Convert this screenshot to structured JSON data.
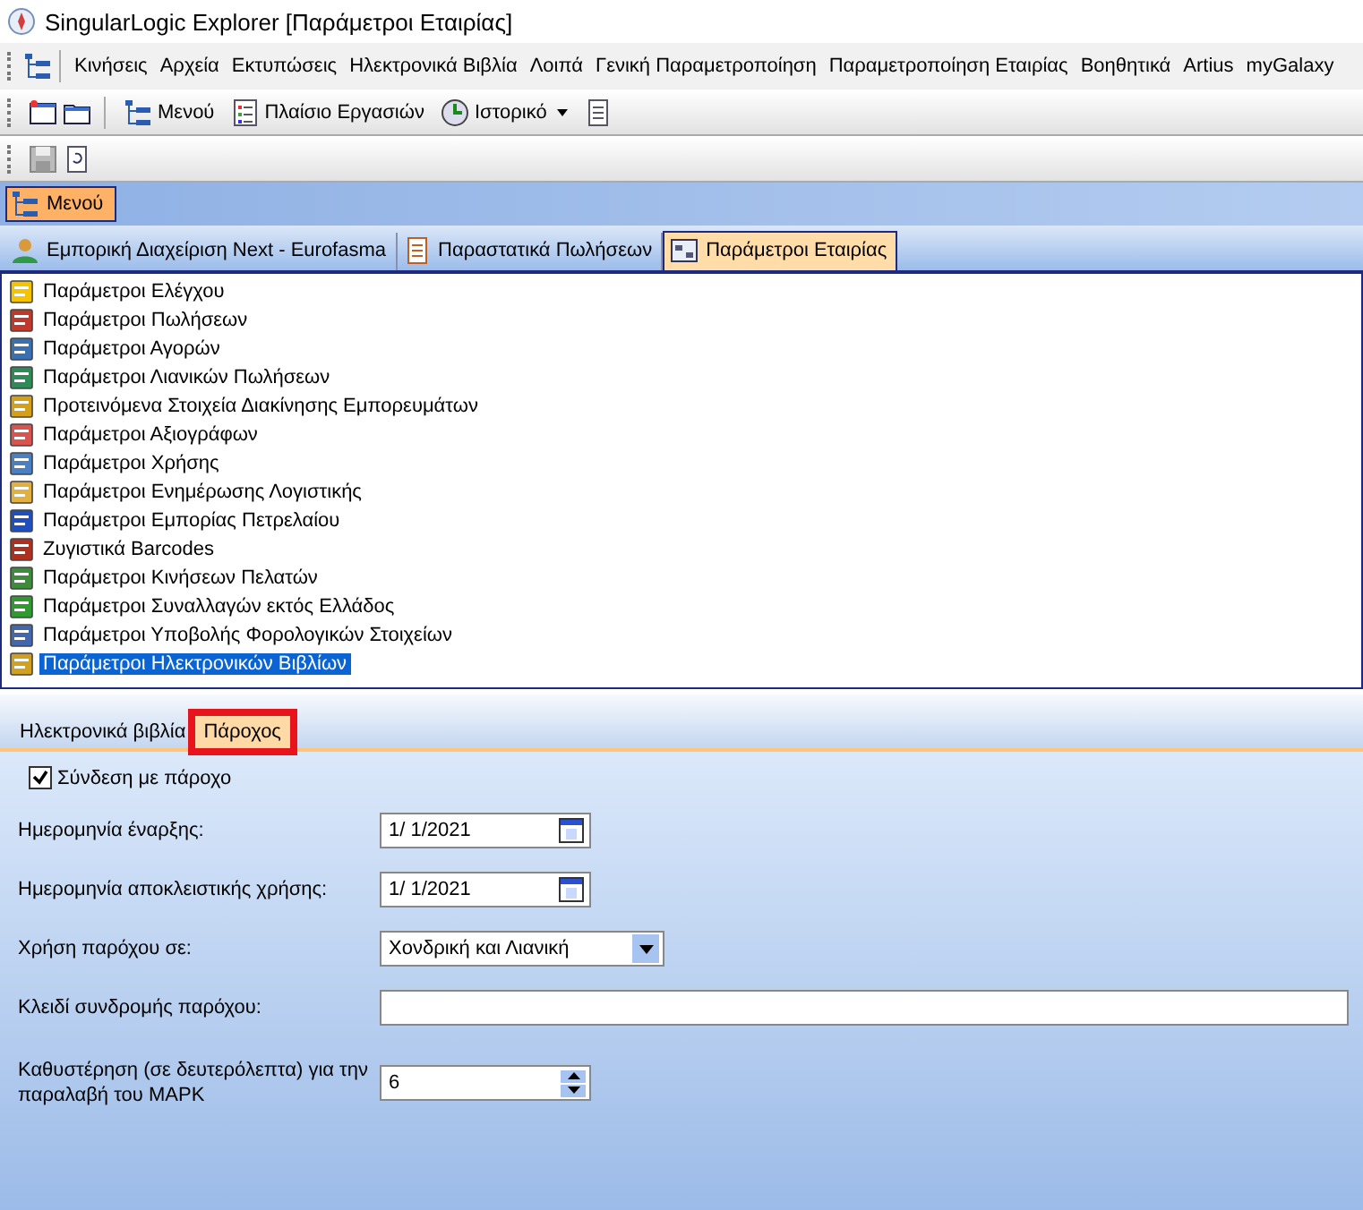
{
  "window": {
    "title": "SingularLogic Explorer [Παράμετροι Εταιρίας]"
  },
  "menu_bar": [
    "Κινήσεις",
    "Αρχεία",
    "Εκτυπώσεις",
    "Ηλεκτρονικά Βιβλία",
    "Λοιπά",
    "Γενική Παραμετροποίηση",
    "Παραμετροποίηση Εταιρίας",
    "Βοηθητικά",
    "Artius",
    "myGalaxy"
  ],
  "toolbar": [
    {
      "label": "Μενού",
      "kind": "button"
    },
    {
      "label": "Πλαίσιο Εργασιών",
      "kind": "button"
    },
    {
      "label": "Ιστορικό",
      "kind": "dropdown"
    }
  ],
  "menu_strip": {
    "label": "Μενού",
    "selected": true
  },
  "doc_tabs": [
    {
      "label": "Εμπορική Διαχείριση Next - Eurofasma",
      "selected": false
    },
    {
      "label": "Παραστατικά Πωλήσεων",
      "selected": false
    },
    {
      "label": "Παράμετροι Εταιρίας",
      "selected": true
    }
  ],
  "param_list": [
    {
      "label": "Παράμετροι Ελέγχου",
      "selected": false
    },
    {
      "label": "Παράμετροι Πωλήσεων",
      "selected": false
    },
    {
      "label": "Παράμετροι Αγορών",
      "selected": false
    },
    {
      "label": "Παράμετροι Λιανικών Πωλήσεων",
      "selected": false
    },
    {
      "label": "Προτεινόμενα Στοιχεία Διακίνησης Εμπορευμάτων",
      "selected": false
    },
    {
      "label": "Παράμετροι Αξιογράφων",
      "selected": false
    },
    {
      "label": "Παράμετροι Χρήσης",
      "selected": false
    },
    {
      "label": "Παράμετροι Ενημέρωσης Λογιστικής",
      "selected": false
    },
    {
      "label": "Παράμετροι Εμπορίας Πετρελαίου",
      "selected": false
    },
    {
      "label": "Ζυγιστικά Barcodes",
      "selected": false
    },
    {
      "label": "Παράμετροι Κινήσεων Πελατών",
      "selected": false
    },
    {
      "label": "Παράμετροι Συναλλαγών εκτός Ελλάδος",
      "selected": false
    },
    {
      "label": "Παράμετροι Υποβολής Φορολογικών Στοιχείων",
      "selected": false
    },
    {
      "label": "Παράμετροι Ηλεκτρονικών Βιβλίων",
      "selected": true
    }
  ],
  "sub_tabs": [
    {
      "label": "Ηλεκτρονικά βιβλία",
      "selected": false,
      "highlighted": false
    },
    {
      "label": "Πάροχος",
      "selected": true,
      "highlighted": true
    }
  ],
  "form": {
    "checkbox": {
      "label": "Σύνδεση με πάροχο",
      "checked": true
    },
    "fields": [
      {
        "label": "Ημερομηνία έναρξης:",
        "kind": "date",
        "value": "1/ 1/2021"
      },
      {
        "label": "Ημερομηνία αποκλειστικής χρήσης:",
        "kind": "date",
        "value": "1/ 1/2021"
      },
      {
        "label": "Χρήση παρόχου σε:",
        "kind": "select",
        "value": "Χονδρική και Λιανική"
      },
      {
        "label": "Κλειδί συνδρομής παρόχου:",
        "kind": "text"
      },
      {
        "label": "Καθυστέρηση (σε δευτερόλεπτα) για την παραλαβή του ΜΑΡΚ",
        "kind": "spin",
        "value": "6"
      }
    ]
  }
}
